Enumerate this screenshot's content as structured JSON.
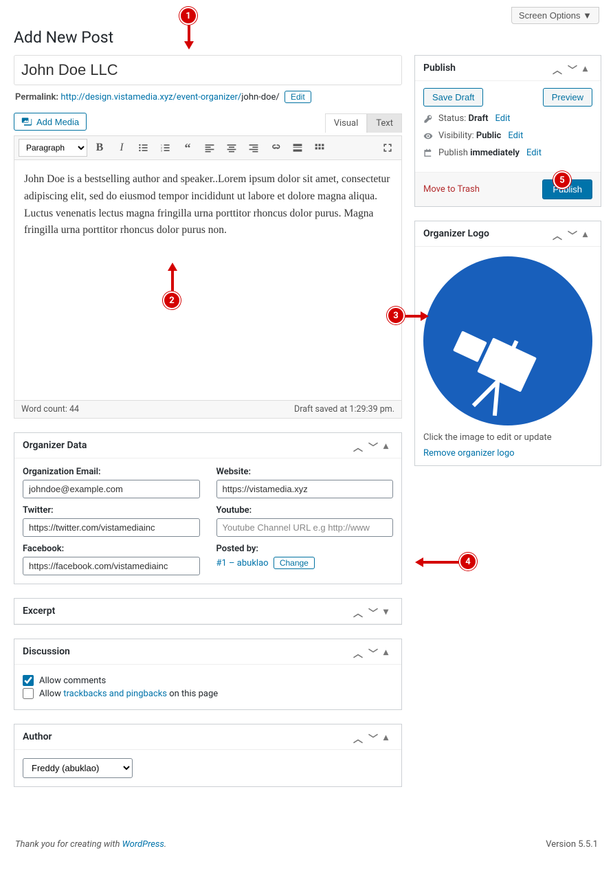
{
  "screen_options": "Screen Options  ▼",
  "page_title": "Add New Post",
  "title_value": "John Doe LLC",
  "permalink": {
    "label": "Permalink:",
    "base": "http://design.vistamedia.xyz/event-organizer/",
    "slug": "john-doe/",
    "edit": "Edit"
  },
  "add_media": "Add Media",
  "editor_tabs": {
    "visual": "Visual",
    "text": "Text"
  },
  "format_selected": "Paragraph",
  "editor_content": "John Doe is a bestselling author and speaker..Lorem ipsum dolor sit amet, consectetur adipiscing elit, sed do eiusmod tempor incididunt ut labore et dolore magna aliqua. Luctus venenatis lectus magna fringilla urna porttitor rhoncus dolor purus. Magna fringilla urna porttitor rhoncus dolor purus non.",
  "word_count_label": "Word count: 44",
  "draft_saved": "Draft saved at 1:29:39 pm.",
  "organizer_data": {
    "heading": "Organizer Data",
    "email_label": "Organization Email:",
    "email_value": "johndoe@example.com",
    "website_label": "Website:",
    "website_value": "https://vistamedia.xyz",
    "twitter_label": "Twitter:",
    "twitter_value": "https://twitter.com/vistamediainc",
    "youtube_label": "Youtube:",
    "youtube_placeholder": "Youtube Channel URL e.g http://www",
    "facebook_label": "Facebook:",
    "facebook_value": "https://facebook.com/vistamediainc",
    "posted_by_label": "Posted by:",
    "posted_by_value": "#1 – abuklao",
    "change": "Change"
  },
  "excerpt_heading": "Excerpt",
  "discussion": {
    "heading": "Discussion",
    "allow_comments": "Allow comments",
    "allow_part1": "Allow ",
    "trackbacks_link": "trackbacks and pingbacks",
    "allow_part2": " on this page"
  },
  "author": {
    "heading": "Author",
    "selected": "Freddy (abuklao)"
  },
  "publish": {
    "heading": "Publish",
    "save_draft": "Save Draft",
    "preview": "Preview",
    "status_label": "Status: ",
    "status_value": "Draft",
    "visibility_label": "Visibility: ",
    "visibility_value": "Public",
    "schedule_label": "Publish ",
    "schedule_value": "immediately",
    "edit": "Edit",
    "trash": "Move to Trash",
    "publish_btn": "Publish"
  },
  "logo": {
    "heading": "Organizer Logo",
    "caption": "Click the image to edit or update",
    "remove": "Remove organizer logo"
  },
  "footer": {
    "thanks_pre": "Thank you for creating with ",
    "wp": "WordPress",
    "dot": ".",
    "version": "Version 5.5.1"
  },
  "annotations": [
    "1",
    "2",
    "3",
    "4",
    "5"
  ]
}
